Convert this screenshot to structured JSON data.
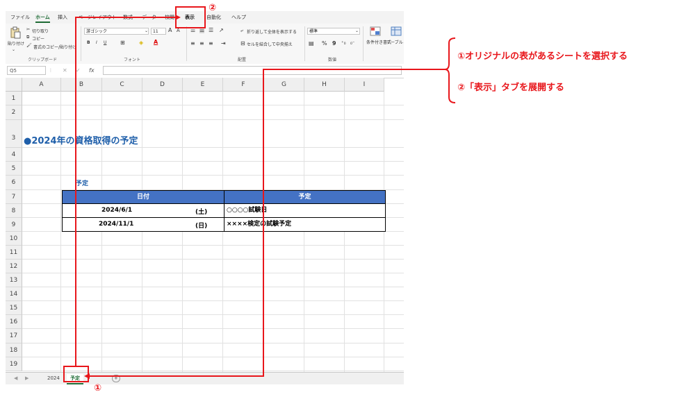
{
  "ribbon_tabs": [
    "ファイル",
    "ホーム",
    "挿入",
    "ページレイアウト",
    "数式",
    "データ",
    "校閲",
    "表示",
    "自動化",
    "ヘルプ"
  ],
  "clipboard": {
    "paste": "貼り付け",
    "cut": "切り取り",
    "copy": "コピー",
    "format_painter": "書式のコピー/貼り付け",
    "group": "クリップボード"
  },
  "font": {
    "name": "游ゴシック",
    "size": "11",
    "grow": "A",
    "shrink": "A",
    "bold": "B",
    "italic": "I",
    "underline": "U",
    "group": "フォント"
  },
  "alignment": {
    "wrap": "折り返して全体を表示する",
    "merge": "セルを結合して中央揃え",
    "group": "配置"
  },
  "number": {
    "format": "標準",
    "percent": "%",
    "comma": "9",
    "group": "数値"
  },
  "styles": {
    "conditional": "条件付き書式",
    "table": "テーブルとして書式設定"
  },
  "formula_bar": {
    "name_box": "Q5",
    "fx": "fx"
  },
  "columns": [
    "A",
    "B",
    "C",
    "D",
    "E",
    "F",
    "G",
    "H",
    "I"
  ],
  "rows": [
    "1",
    "2",
    "3",
    "4",
    "5",
    "6",
    "7",
    "8",
    "9",
    "10",
    "11",
    "12",
    "13",
    "14",
    "15",
    "16",
    "17",
    "18",
    "19"
  ],
  "sheet": {
    "title": "●2024年の資格取得の予定",
    "label": "予定",
    "table": {
      "headers": [
        "日付",
        "予定"
      ],
      "rows": [
        {
          "date": "2024/6/1",
          "day": "(土)",
          "plan": "○○○○試験日"
        },
        {
          "date": "2024/11/1",
          "day": "(日)",
          "plan": "××××検定の試験予定"
        }
      ]
    }
  },
  "sheet_tabs": [
    "2024",
    "予定",
    "+"
  ],
  "annotations": {
    "step1": "①オリジナルの表があるシートを選択する",
    "step2": "②「表示」タブを展開する",
    "marker1": "①",
    "marker2": "②"
  },
  "colors": {
    "accent_red": "#e8161b",
    "header_blue": "#4472c4",
    "title_blue": "#1f5faa",
    "excel_green": "#1e6b35"
  }
}
